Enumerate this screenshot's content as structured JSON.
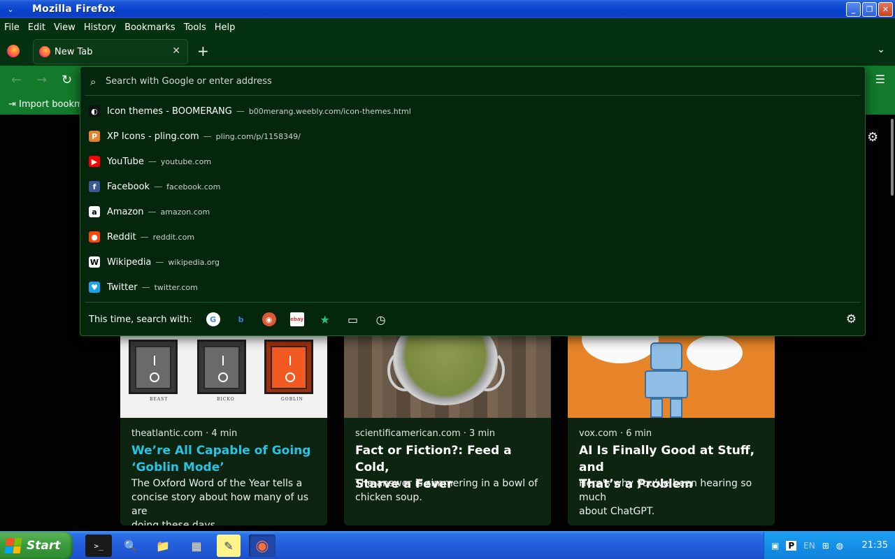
{
  "window": {
    "title": "Mozilla Firefox",
    "sys_menu": "⌄",
    "min": "_",
    "max": "❐",
    "close": "✕"
  },
  "menubar": [
    "File",
    "Edit",
    "View",
    "History",
    "Bookmarks",
    "Tools",
    "Help"
  ],
  "tabs": [
    {
      "label": "New Tab",
      "close": "✕"
    }
  ],
  "tabbar": {
    "new_tab": "+",
    "list_all": "⌄"
  },
  "nav": {
    "back": "←",
    "forward": "→",
    "reload": "↻",
    "menu": "☰"
  },
  "bookmarks": {
    "import_label": "Import bookm"
  },
  "urlbar": {
    "placeholder": "Search with Google or enter address",
    "value": "",
    "search_glyph": "⌕"
  },
  "suggestions": [
    {
      "title": "Icon themes - BOOMERANG",
      "url": "b00merang.weebly.com/icon-themes.html",
      "icon": "boomerang-icon",
      "color": "#111111",
      "glyph": "◐"
    },
    {
      "title": "XP Icons - pling.com",
      "url": "pling.com/p/1158349/",
      "icon": "pling-icon",
      "color": "#e8822a",
      "glyph": "P"
    },
    {
      "title": "YouTube",
      "url": "youtube.com",
      "icon": "youtube-icon",
      "color": "#ff0000",
      "glyph": "▶"
    },
    {
      "title": "Facebook",
      "url": "facebook.com",
      "icon": "facebook-icon",
      "color": "#3b5998",
      "glyph": "f"
    },
    {
      "title": "Amazon",
      "url": "amazon.com",
      "icon": "amazon-icon",
      "color": "#ffffff",
      "glyph": "a"
    },
    {
      "title": "Reddit",
      "url": "reddit.com",
      "icon": "reddit-icon",
      "color": "#ff4500",
      "glyph": "●"
    },
    {
      "title": "Wikipedia",
      "url": "wikipedia.org",
      "icon": "wikipedia-icon",
      "color": "#ffffff",
      "glyph": "W"
    },
    {
      "title": "Twitter",
      "url": "twitter.com",
      "icon": "twitter-icon",
      "color": "#1da1f2",
      "glyph": "♥"
    }
  ],
  "search_with": {
    "label": "This time, search with:",
    "engines": [
      {
        "name": "google-icon",
        "glyph": "G",
        "bg": "#ffffff",
        "fg": "#4285f4"
      },
      {
        "name": "bing-icon",
        "glyph": "b",
        "bg": "transparent",
        "fg": "#2a8ad4"
      },
      {
        "name": "duckduckgo-icon",
        "glyph": "◉",
        "bg": "#de5833",
        "fg": "#ffffff"
      },
      {
        "name": "ebay-icon",
        "glyph": "ebay",
        "bg": "#ffffff",
        "fg": "#e53238"
      },
      {
        "name": "bookmarks-star-icon",
        "glyph": "★",
        "bg": "transparent",
        "fg": "#2ac37a"
      },
      {
        "name": "tabs-icon",
        "glyph": "▭",
        "bg": "transparent",
        "fg": "#ffffff"
      },
      {
        "name": "history-clock-icon",
        "glyph": "◷",
        "bg": "transparent",
        "fg": "#ffffff"
      }
    ],
    "settings_glyph": "⚙"
  },
  "newtab": {
    "settings_glyph": "⚙"
  },
  "stories": [
    {
      "source": "theatlantic.com · 4 min",
      "title_line1": "We’re All Capable of Going",
      "title_line2": "‘Goblin Mode’",
      "excerpt1": "The Oxford Word of the Year tells a",
      "excerpt2": "concise story about how many of us are",
      "excerpt3": "doing these days.",
      "labels": [
        "BEAST",
        "BICKO",
        "GOBLIN"
      ]
    },
    {
      "source": "scientificamerican.com · 3 min",
      "title_line1": "Fact or Fiction?: Feed a Cold,",
      "title_line2": "Starve a Fever",
      "excerpt1": "The answer is simmering in a bowl of",
      "excerpt2": "chicken soup.",
      "excerpt3": ""
    },
    {
      "source": "vox.com · 6 min",
      "title_line1": "AI Is Finally Good at Stuff, and",
      "title_line2": "That’s a Problem",
      "excerpt1": "Here’s why you’ve been hearing so much",
      "excerpt2": "about ChatGPT.",
      "excerpt3": ""
    }
  ],
  "taskbar": {
    "start_label": "Start",
    "apps": [
      {
        "name": "terminal-icon",
        "glyph": ">_"
      },
      {
        "name": "search-folder-icon",
        "glyph": "🔍"
      },
      {
        "name": "file-manager-icon",
        "glyph": "📁"
      },
      {
        "name": "control-panel-icon",
        "glyph": "▦"
      },
      {
        "name": "notepad-icon",
        "glyph": "✎"
      },
      {
        "name": "firefox-taskbar-icon",
        "glyph": "◉"
      }
    ],
    "tray": {
      "lang": "EN",
      "clock": "21:35"
    }
  }
}
